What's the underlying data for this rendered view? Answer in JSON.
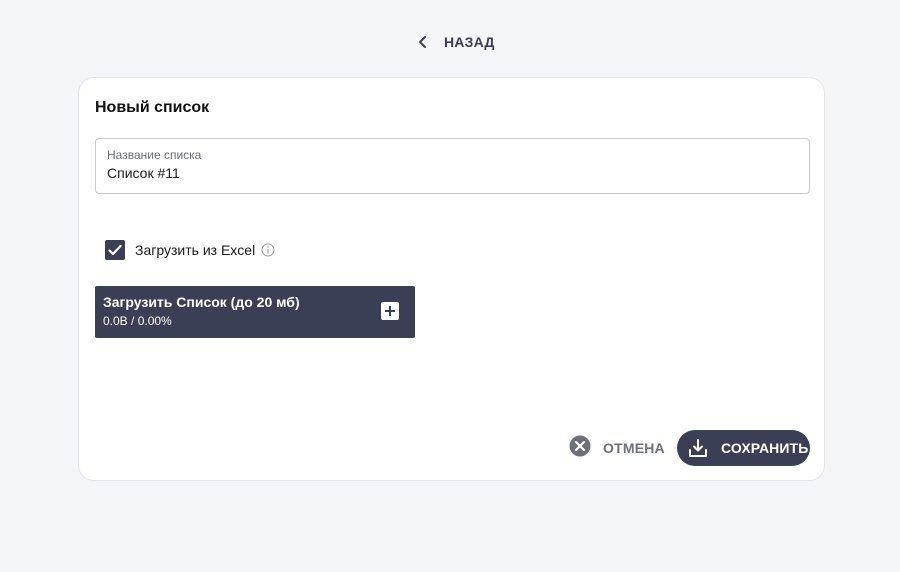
{
  "nav": {
    "back_label": "НАЗАД",
    "back_icon": "chevron-left-icon"
  },
  "form": {
    "title": "Новый список",
    "name_field": {
      "label": "Название списка",
      "value": "Список #11"
    },
    "excel_option": {
      "label": "Загрузить из Excel",
      "checked": true,
      "info_icon": "info-icon"
    },
    "upload": {
      "title": "Загрузить Список (до 20 мб)",
      "progress_text": "0.0B / 0.00%",
      "progress": 0,
      "add_icon": "plus-icon"
    }
  },
  "actions": {
    "cancel_label": "ОТМЕНА",
    "cancel_icon": "close-circle-icon",
    "save_label": "СОХРАНИТЬ",
    "save_icon": "download-icon"
  },
  "colors": {
    "primary": "#3b3f55",
    "background": "#f4f5f9",
    "card": "#ffffff",
    "muted_text": "#6e717a"
  }
}
